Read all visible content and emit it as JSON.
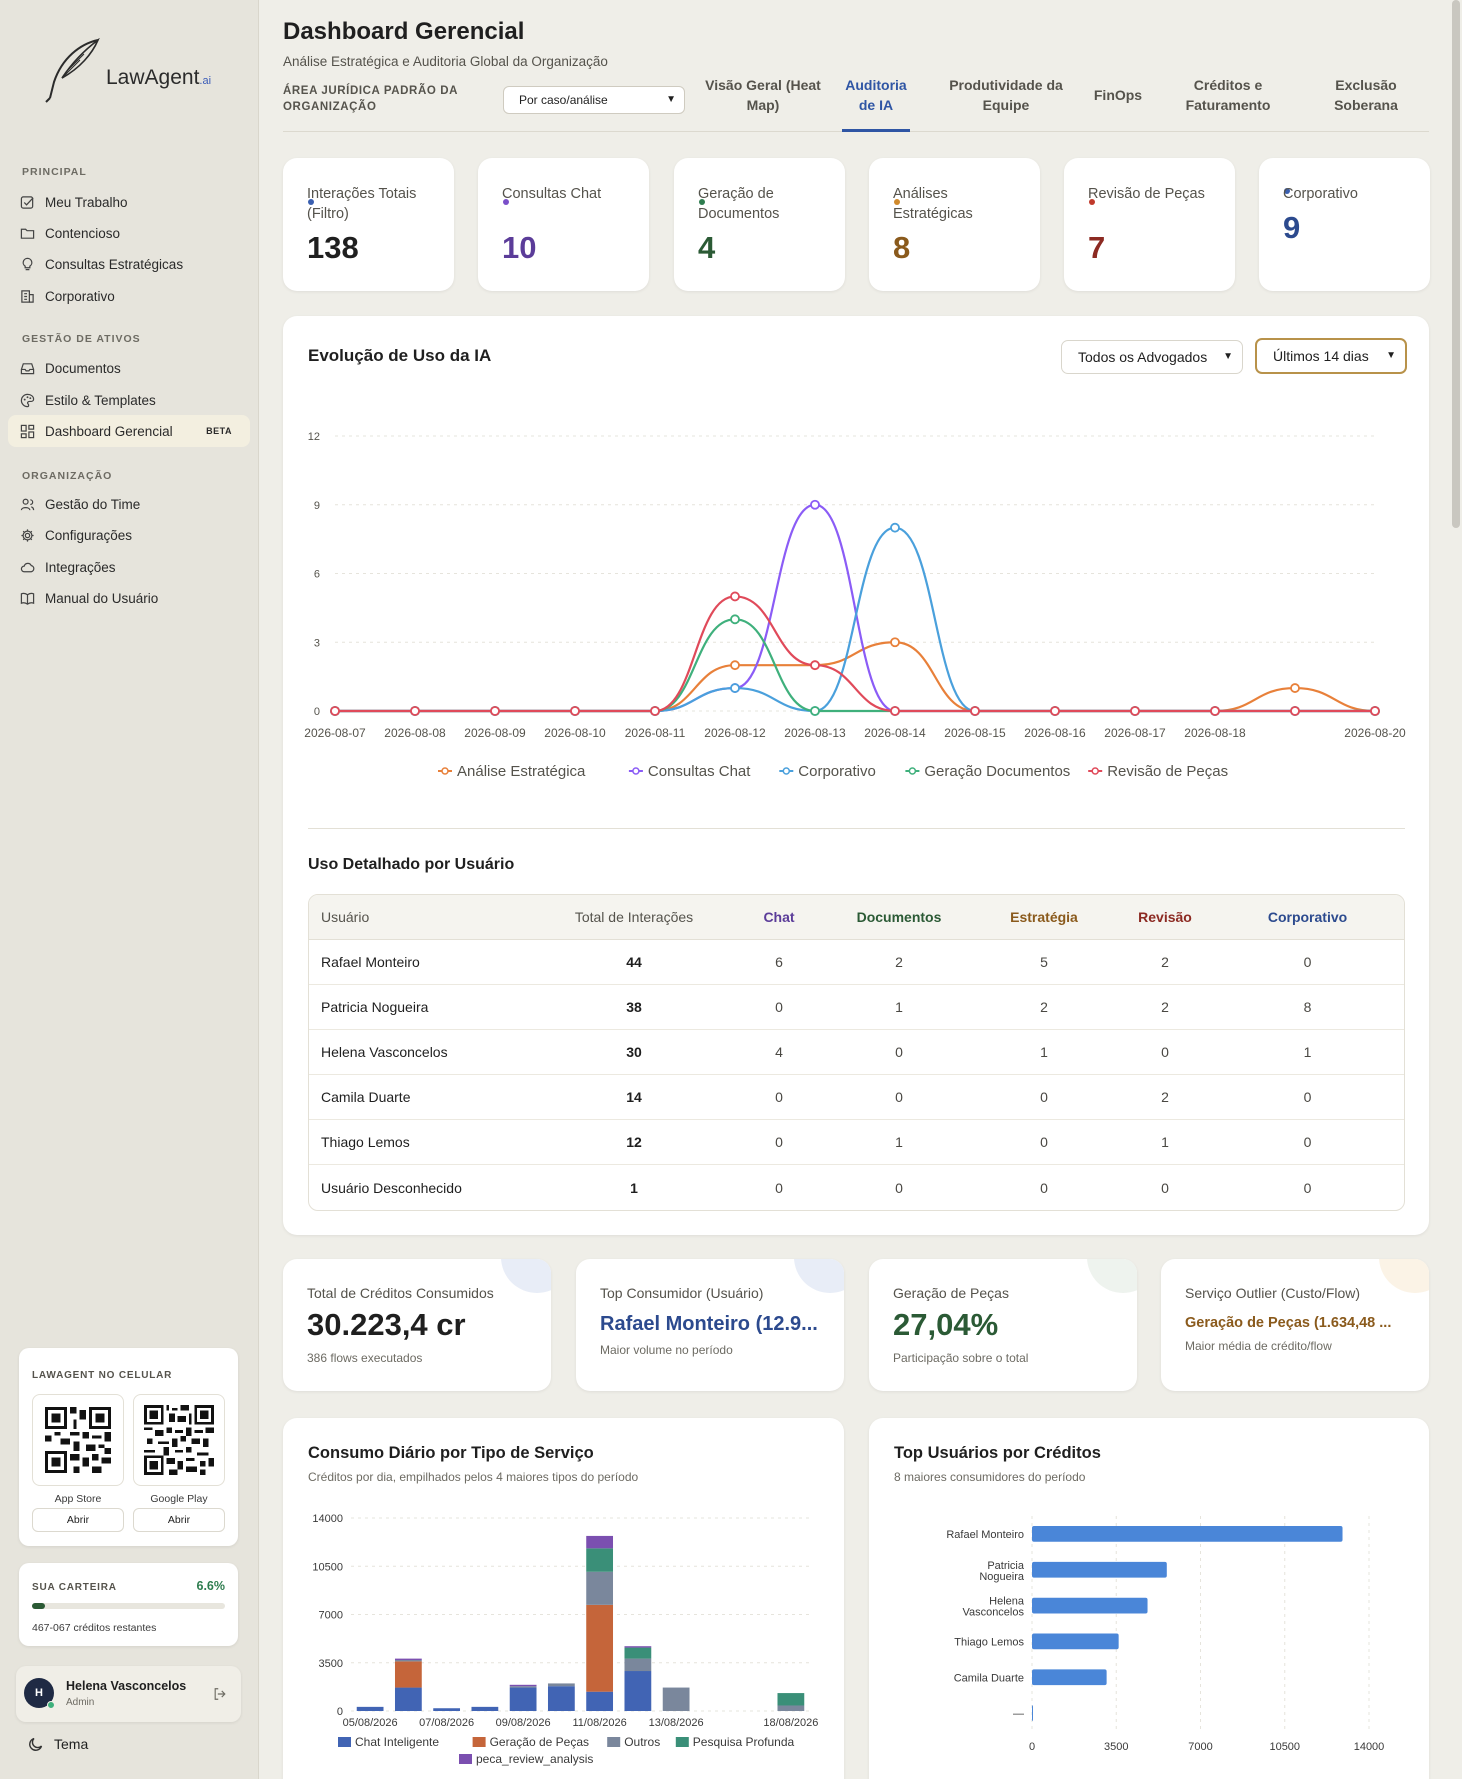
{
  "brand": {
    "name": "LawAgent",
    "suffix": ".ai"
  },
  "sidebar": {
    "sections": [
      {
        "label": "PRINCIPAL"
      },
      {
        "label": "GESTÃO DE ATIVOS"
      },
      {
        "label": "ORGANIZAÇÃO"
      }
    ],
    "items": [
      {
        "label": "Meu Trabalho",
        "icon": "checkbox-icon"
      },
      {
        "label": "Contencioso",
        "icon": "folder-icon"
      },
      {
        "label": "Consultas Estratégicas",
        "icon": "lightbulb-icon"
      },
      {
        "label": "Corporativo",
        "icon": "building-icon"
      },
      {
        "label": "Documentos",
        "icon": "inbox-icon"
      },
      {
        "label": "Estilo & Templates",
        "icon": "palette-icon"
      },
      {
        "label": "Dashboard Gerencial",
        "icon": "grid-icon",
        "badge": "BETA"
      },
      {
        "label": "Gestão do Time",
        "icon": "users-icon"
      },
      {
        "label": "Configurações",
        "icon": "gear-icon"
      },
      {
        "label": "Integrações",
        "icon": "cloud-icon"
      },
      {
        "label": "Manual do Usuário",
        "icon": "book-icon"
      }
    ],
    "mobile": {
      "title": "LAWAGENT NO CELULAR",
      "app_store": "App Store",
      "google_play": "Google Play",
      "open": "Abrir"
    },
    "wallet": {
      "title": "SUA CARTEIRA",
      "percent": "6.6%",
      "fill": 0.066,
      "remaining": "467-067",
      "remaining_label": "créditos restantes"
    },
    "user": {
      "initial": "H",
      "name": "Helena Vasconcelos",
      "role": "Admin"
    },
    "theme": "Tema"
  },
  "header": {
    "title": "Dashboard Gerencial",
    "subtitle": "Análise Estratégica e Auditoria Global da Organização",
    "area_label": "ÁREA JURÍDICA PADRÃO DA ORGANIZAÇÃO",
    "area_value": "Por caso/análise"
  },
  "tabs": [
    {
      "label": "Visão Geral (Heat Map)"
    },
    {
      "label": "Auditoria de IA"
    },
    {
      "label": "Produtividade da Equipe"
    },
    {
      "label": "FinOps"
    },
    {
      "label": "Créditos e Faturamento"
    },
    {
      "label": "Exclusão Soberana"
    }
  ],
  "kpis": [
    {
      "label": "Interações Totais (Filtro)",
      "value": "138",
      "color": "#3a5fb0",
      "value_color": "#1f1f1f"
    },
    {
      "label": "Consultas Chat",
      "value": "10",
      "color": "#7a4fc9",
      "value_color": "#5b3c99"
    },
    {
      "label": "Geração de Documentos",
      "value": "4",
      "color": "#2e7d4f",
      "value_color": "#2b5a35"
    },
    {
      "label": "Análises Estratégicas",
      "value": "8",
      "color": "#d08a2c",
      "value_color": "#8a5a1c"
    },
    {
      "label": "Revisão de Peças",
      "value": "7",
      "color": "#c0392b",
      "value_color": "#8c2a22"
    },
    {
      "label": "Corporativo",
      "value": "9",
      "color": "#3a5fb0",
      "value_color": "#2c4a8e"
    }
  ],
  "usage": {
    "title": "Evolução de Uso da IA",
    "filter_lawyers": "Todos os Advogados",
    "filter_period": "Últimos 14 dias"
  },
  "table": {
    "title": "Uso Detalhado por Usuário",
    "headers": [
      "Usuário",
      "Total de Interações",
      "Chat",
      "Documentos",
      "Estratégia",
      "Revisão",
      "Corporativo"
    ],
    "header_colors": [
      "#55534c",
      "#55534c",
      "#5b3c99",
      "#2b5a35",
      "#8a5a1c",
      "#8c2a22",
      "#2c4a8e"
    ],
    "rows": [
      [
        "Rafael Monteiro",
        "44",
        "6",
        "2",
        "5",
        "2",
        "0"
      ],
      [
        "Patricia Nogueira",
        "38",
        "0",
        "1",
        "2",
        "2",
        "8"
      ],
      [
        "Helena Vasconcelos",
        "30",
        "4",
        "0",
        "1",
        "0",
        "1"
      ],
      [
        "Camila Duarte",
        "14",
        "0",
        "0",
        "0",
        "2",
        "0"
      ],
      [
        "Thiago Lemos",
        "12",
        "0",
        "1",
        "0",
        "1",
        "0"
      ],
      [
        "Usuário Desconhecido",
        "1",
        "0",
        "0",
        "0",
        "0",
        "0"
      ]
    ]
  },
  "stats": [
    {
      "label": "Total de Créditos Consumidos",
      "value": "30.223,4 cr",
      "sub": "386 flows executados",
      "color": "#1f1f1f",
      "circle": "#e8edf7"
    },
    {
      "label": "Top Consumidor (Usuário)",
      "value": "Rafael Monteiro (12.9...",
      "sub": "Maior volume no período",
      "color": "#2c4a8e",
      "circle": "#e8edf7"
    },
    {
      "label": "Geração de Peças",
      "value": "27,04%",
      "sub": "Participação sobre o total",
      "color": "#2b5a35",
      "circle": "#eef3ee"
    },
    {
      "label": "Serviço Outlier (Custo/Flow)",
      "value": "Geração de Peças (1.634,48 ...",
      "sub": "Maior média de crédito/flow",
      "color": "#8a5a1c",
      "circle": "#fbf3e6"
    }
  ],
  "chart_data": [
    {
      "type": "line",
      "title": "Evolução de Uso da IA",
      "x": [
        "2026-08-07",
        "2026-08-08",
        "2026-08-09",
        "2026-08-10",
        "2026-08-11",
        "2026-08-12",
        "2026-08-13",
        "2026-08-14",
        "2026-08-15",
        "2026-08-16",
        "2026-08-17",
        "2026-08-18",
        "2026-08-19",
        "2026-08-20"
      ],
      "x_tick_labels": [
        "2026-08-07",
        "2026-08-08",
        "2026-08-09",
        "2026-08-10",
        "2026-08-11",
        "2026-08-12",
        "2026-08-13",
        "2026-08-14",
        "2026-08-15",
        "2026-08-16",
        "2026-08-17",
        "2026-08-18",
        "",
        "2026-08-20"
      ],
      "ylim": [
        0,
        12
      ],
      "yticks": [
        0,
        3,
        6,
        9,
        12
      ],
      "legend": "bottom",
      "series": [
        {
          "name": "Análise Estratégica",
          "color": "#e8803a",
          "values": [
            0,
            0,
            0,
            0,
            0,
            2,
            2,
            3,
            0,
            0,
            0,
            0,
            1,
            0
          ]
        },
        {
          "name": "Consultas Chat",
          "color": "#8b5cf6",
          "values": [
            0,
            0,
            0,
            0,
            0,
            1,
            9,
            0,
            0,
            0,
            0,
            0,
            0,
            0
          ]
        },
        {
          "name": "Corporativo",
          "color": "#4aa0dc",
          "values": [
            0,
            0,
            0,
            0,
            0,
            1,
            0,
            8,
            0,
            0,
            0,
            0,
            0,
            0
          ]
        },
        {
          "name": "Geração Documentos",
          "color": "#3fb07c",
          "values": [
            0,
            0,
            0,
            0,
            0,
            4,
            0,
            0,
            0,
            0,
            0,
            0,
            0,
            0
          ]
        },
        {
          "name": "Revisão de Peças",
          "color": "#e04a5a",
          "values": [
            0,
            0,
            0,
            0,
            0,
            5,
            2,
            0,
            0,
            0,
            0,
            0,
            0,
            0
          ]
        }
      ]
    },
    {
      "type": "bar",
      "stacked": true,
      "title": "Consumo Diário por Tipo de Serviço",
      "subtitle": "Créditos por dia, empilhados pelos 4 maiores tipos do período",
      "categories": [
        "05/08/2026",
        "06/08/2026",
        "07/08/2026",
        "08/08/2026",
        "09/08/2026",
        "10/08/2026",
        "11/08/2026",
        "12/08/2026",
        "13/08/2026",
        "14/08/2026",
        "15/08/2026",
        "18/08/2026"
      ],
      "x_tick_labels": [
        "05/08/2026",
        "",
        "07/08/2026",
        "",
        "09/08/2026",
        "",
        "11/08/2026",
        "",
        "13/08/2026",
        "",
        "",
        "18/08/2026"
      ],
      "ylim": [
        0,
        14000
      ],
      "yticks": [
        0,
        3500,
        7000,
        10500,
        14000
      ],
      "legend": "bottom",
      "series": [
        {
          "name": "Chat Inteligente",
          "color": "#4164b4",
          "values": [
            300,
            1700,
            200,
            300,
            1700,
            1800,
            1400,
            2900,
            0,
            0,
            0,
            0
          ]
        },
        {
          "name": "Geração de Peças",
          "color": "#c5653a",
          "values": [
            0,
            1900,
            0,
            0,
            0,
            0,
            6300,
            0,
            0,
            0,
            0,
            0
          ]
        },
        {
          "name": "Outros",
          "color": "#7a879c",
          "values": [
            0,
            100,
            0,
            0,
            100,
            200,
            2400,
            900,
            1700,
            0,
            0,
            400
          ]
        },
        {
          "name": "Pesquisa Profunda",
          "color": "#3a8f78",
          "values": [
            0,
            0,
            0,
            0,
            0,
            0,
            1700,
            800,
            0,
            0,
            0,
            900
          ]
        },
        {
          "name": "peca_review_analysis",
          "color": "#7b4fb0",
          "values": [
            0,
            100,
            0,
            0,
            100,
            0,
            900,
            100,
            0,
            0,
            0,
            0
          ]
        }
      ]
    },
    {
      "type": "bar",
      "orientation": "horizontal",
      "title": "Top Usuários por Créditos",
      "subtitle": "8 maiores consumidores do período",
      "categories": [
        "Rafael Monteiro",
        "Patricia Nogueira",
        "Helena Vasconcelos",
        "Thiago Lemos",
        "Camila Duarte",
        "—"
      ],
      "values": [
        12900,
        5600,
        4800,
        3600,
        3100,
        30
      ],
      "xlim": [
        0,
        14000
      ],
      "xticks": [
        0,
        3500,
        7000,
        10500,
        14000
      ],
      "color": "#4a86d8"
    }
  ]
}
